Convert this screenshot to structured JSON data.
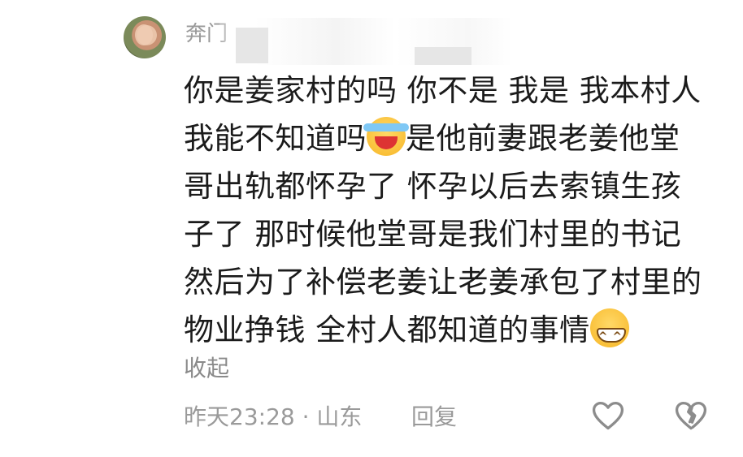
{
  "user": {
    "name": "奔门"
  },
  "comment": {
    "lines": [
      "你是姜家村的吗 你不是 我是 我本村人",
      "我能不知道吗",
      "是他前妻跟老姜他堂",
      "哥出轨都怀孕了 怀孕以后去索镇生孩",
      "子了 那时候他堂哥是我们村里的书记",
      "然后为了补偿老姜让老姜承包了村里的",
      "物业挣钱 全村人都知道的事情"
    ]
  },
  "collapse_label": "收起",
  "meta": {
    "time": "昨天23:28",
    "separator": " · ",
    "location": "山东"
  },
  "reply_label": "回复",
  "icons": {
    "like": "heart-outline-icon",
    "dislike": "broken-heart-icon",
    "emoji1": "laughing-crying-emoji",
    "emoji2": "grinning-emoji"
  },
  "colors": {
    "text": "#1b1b1b",
    "secondary": "#9a9a9a"
  }
}
